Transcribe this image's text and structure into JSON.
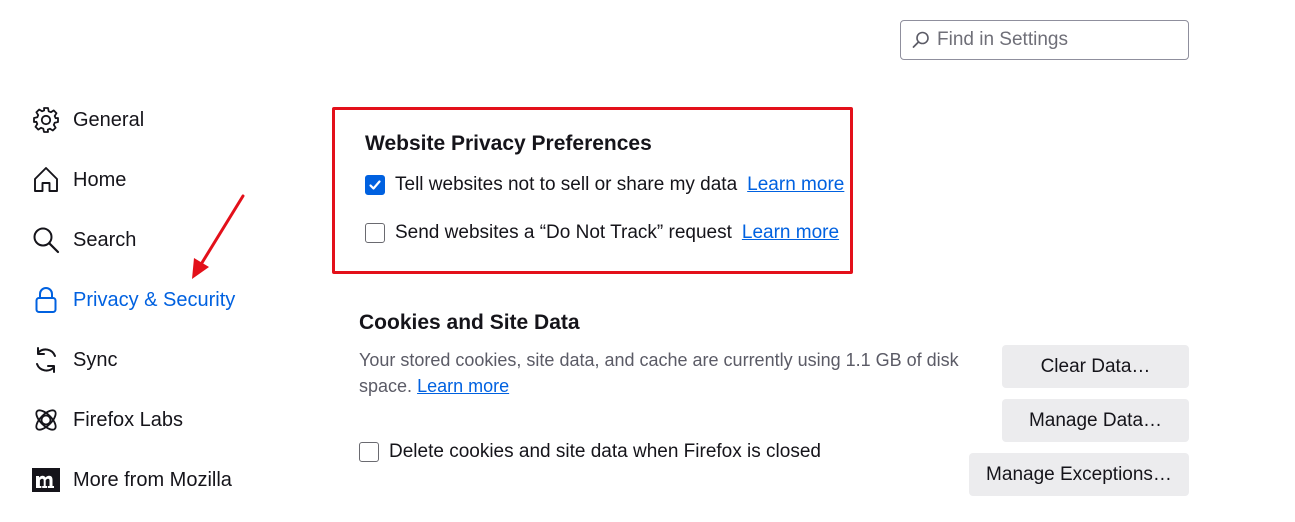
{
  "search": {
    "placeholder": "Find in Settings"
  },
  "sidebar": {
    "items": [
      {
        "label": "General",
        "icon": "gear-icon"
      },
      {
        "label": "Home",
        "icon": "home-icon"
      },
      {
        "label": "Search",
        "icon": "search-icon"
      },
      {
        "label": "Privacy & Security",
        "icon": "lock-icon",
        "active": true
      },
      {
        "label": "Sync",
        "icon": "sync-icon"
      },
      {
        "label": "Firefox Labs",
        "icon": "labs-icon"
      },
      {
        "label": "More from Mozilla",
        "icon": "mozilla-icon"
      }
    ]
  },
  "privacy": {
    "title": "Website Privacy Preferences",
    "gpc": {
      "label": "Tell websites not to sell or share my data",
      "link": "Learn more",
      "checked": true
    },
    "dnt": {
      "label": "Send websites a “Do Not Track” request",
      "link": "Learn more",
      "checked": false
    }
  },
  "cookies": {
    "title": "Cookies and Site Data",
    "description": "Your stored cookies, site data, and cache are currently using 1.1 GB of disk space.",
    "link": "Learn more",
    "delete_label": "Delete cookies and site data when Firefox is closed",
    "delete_checked": false,
    "buttons": {
      "clear": "Clear Data…",
      "manage": "Manage Data…",
      "exceptions": "Manage Exceptions…"
    }
  },
  "colors": {
    "accent": "#0061e0",
    "highlight_border": "#e3101a",
    "annotation_arrow": "#e3101a"
  }
}
